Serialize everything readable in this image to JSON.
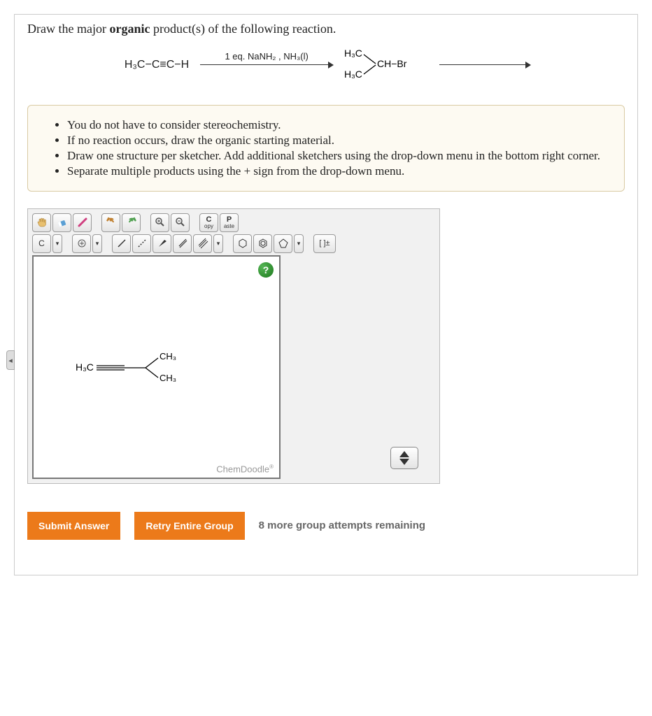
{
  "prompt": {
    "prefix": "Draw the major ",
    "bold": "organic",
    "suffix": " product(s) of the following reaction."
  },
  "reaction": {
    "start_material": "H₃C−C≡C−H",
    "reagent_label": "1 eq. NaNH₂ , NH₃(l)",
    "second_reagent_top_left": "H₃C",
    "second_reagent_bot_left": "H₃C",
    "second_reagent_right": "CH−Br"
  },
  "instructions": {
    "items": [
      "You do not have to consider stereochemistry.",
      "If no reaction occurs, draw the organic starting material.",
      "Draw one structure per sketcher. Add additional sketchers using the drop-down menu in the bottom right corner.",
      "Separate multiple products using the + sign from the drop-down menu."
    ]
  },
  "toolbar": {
    "copy_top": "C",
    "copy_bot": "opy",
    "paste_top": "P",
    "paste_bot": "aste",
    "atom_c": "C",
    "charge_btn": "[ ]±"
  },
  "canvas": {
    "help": "?",
    "drawn_left": "H₃C",
    "drawn_top": "CH₃",
    "drawn_bot": "CH₃",
    "brand": "ChemDoodle",
    "brand_sup": "®"
  },
  "buttons": {
    "submit": "Submit Answer",
    "retry": "Retry Entire Group"
  },
  "attempts_text": "8 more group attempts remaining",
  "side_tab": "◂"
}
